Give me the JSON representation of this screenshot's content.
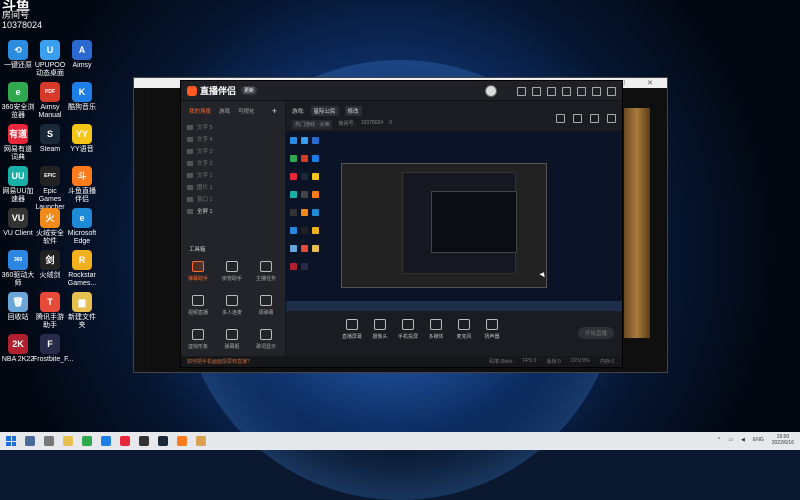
{
  "corner_badge": {
    "title": "斗鱼",
    "subtitle": "房间号",
    "number": "10378024"
  },
  "desktop_icons": [
    {
      "label": "一键还原",
      "color": "#2b8de0",
      "glyph": "⟲"
    },
    {
      "label": "UPUPOO动态桌面",
      "color": "#3a9ff0",
      "glyph": "U"
    },
    {
      "label": "Aimsy",
      "color": "#2a6ad0",
      "glyph": "A"
    },
    {
      "label": "360安全浏览器",
      "color": "#2fa84f",
      "glyph": "e"
    },
    {
      "label": "Aimsy Manual",
      "color": "#d83a2a",
      "glyph": "PDF"
    },
    {
      "label": "酷狗音乐",
      "color": "#1e7ee8",
      "glyph": "K"
    },
    {
      "label": "网易有道词典",
      "color": "#e8273a",
      "glyph": "有道"
    },
    {
      "label": "Steam",
      "color": "#1b2838",
      "glyph": "S"
    },
    {
      "label": "YY语音",
      "color": "#f5c518",
      "glyph": "YY"
    },
    {
      "label": "网易UU加速器",
      "color": "#1ab0a8",
      "glyph": "UU"
    },
    {
      "label": "Epic Games Launcher",
      "color": "#222222",
      "glyph": "EPIC"
    },
    {
      "label": "斗鱼直播伴侣",
      "color": "#ff7a1a",
      "glyph": "斗"
    },
    {
      "label": "VU Client",
      "color": "#333333",
      "glyph": "VU"
    },
    {
      "label": "火绒安全软件",
      "color": "#f08a1a",
      "glyph": "火"
    },
    {
      "label": "Microsoft Edge",
      "color": "#1f8ad8",
      "glyph": "e"
    },
    {
      "label": "360驱动大师",
      "color": "#2a86e0",
      "glyph": "360"
    },
    {
      "label": "火绒剑",
      "color": "#222222",
      "glyph": "剑"
    },
    {
      "label": "Rockstar Games...",
      "color": "#f2b01e",
      "glyph": "R"
    },
    {
      "label": "回收站",
      "color": "#6aa6d8",
      "glyph": "🗑"
    },
    {
      "label": "腾讯手游助手",
      "color": "#e84a3a",
      "glyph": "T"
    },
    {
      "label": "新建文件夹",
      "color": "#e8c050",
      "glyph": "▆"
    },
    {
      "label": "NBA 2K22",
      "color": "#b02030",
      "glyph": "2K"
    },
    {
      "label": "Frostbite_F...",
      "color": "#2a2a4a",
      "glyph": "F"
    }
  ],
  "app": {
    "name": "直播伴侣",
    "version": "更新",
    "tabs": [
      "我的场景",
      "游戏",
      "可视化"
    ],
    "sources": [
      "文字 5",
      "文字 4",
      "文字 3",
      "文字 2",
      "文字 1",
      "图片 1",
      "窗口 1",
      "全屏 1"
    ],
    "tools_title": "工具箱",
    "tools": [
      "弹幕助手",
      "房管助手",
      "主播任务",
      "视频直播",
      "多人连麦",
      "调弹幕",
      "虚拟形象",
      "弹幕姬",
      "歌词显示"
    ],
    "stream": {
      "category_label": "游戏:",
      "category": "星际公民",
      "modify": "修改",
      "tag1": "热门游戏 · 大神",
      "room_label": "房间号:",
      "room": "10378024",
      "fire": "0"
    },
    "controls": [
      "直播屏幕",
      "摄像头",
      "手机投屏",
      "多媒体",
      "麦克风",
      "扬声器"
    ],
    "start_live": "开始直播",
    "status_warn": "如何把手机画面投屏到直播?",
    "stats": [
      "码率:0kb/s",
      "FPS:0",
      "丢帧:0",
      "CPU:0%",
      "内存:0"
    ]
  },
  "taskbar": {
    "lang": "ENG",
    "time": "19:50",
    "date": "2022/6/16"
  }
}
